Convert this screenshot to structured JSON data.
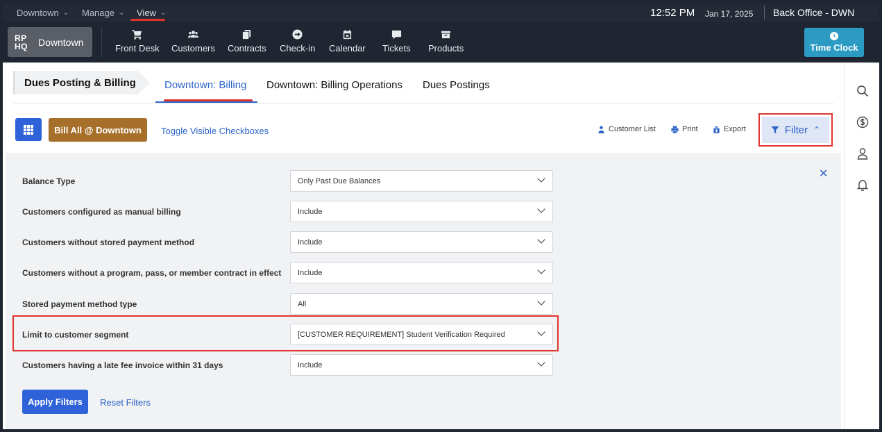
{
  "topbar": {
    "menus": [
      {
        "label": "Downtown"
      },
      {
        "label": "Manage"
      },
      {
        "label": "View"
      }
    ],
    "time": "12:52 PM",
    "date": "Jan 17, 2025",
    "office": "Back Office - DWN"
  },
  "nav": {
    "brand_logo_line1": "RP",
    "brand_logo_line2": "HQ",
    "brand_name": "Downtown",
    "items": [
      {
        "label": "Front Desk",
        "icon": "cart-icon"
      },
      {
        "label": "Customers",
        "icon": "users-icon"
      },
      {
        "label": "Contracts",
        "icon": "contracts-icon"
      },
      {
        "label": "Check-in",
        "icon": "arrow-circle-icon"
      },
      {
        "label": "Calendar",
        "icon": "calendar-icon"
      },
      {
        "label": "Tickets",
        "icon": "chat-icon"
      },
      {
        "label": "Products",
        "icon": "box-icon"
      }
    ],
    "time_clock_label": "Time Clock"
  },
  "breadcrumb": "Dues Posting & Billing",
  "tabs": [
    {
      "label": "Downtown: Billing",
      "active": true
    },
    {
      "label": "Downtown: Billing Operations",
      "active": false
    },
    {
      "label": "Dues Postings",
      "active": false
    }
  ],
  "toolbar": {
    "bill_all_label": "Bill All @ Downtown",
    "toggle_label": "Toggle Visible Checkboxes",
    "customer_list_label": "Customer List",
    "print_label": "Print",
    "export_label": "Export",
    "filter_label": "Filter"
  },
  "filters": [
    {
      "label": "Balance Type",
      "value": "Only Past Due Balances"
    },
    {
      "label": "Customers configured as manual billing",
      "value": "Include"
    },
    {
      "label": "Customers without stored payment method",
      "value": "Include"
    },
    {
      "label": "Customers without a program, pass, or member contract in effect",
      "value": "Include"
    },
    {
      "label": "Stored payment method type",
      "value": "All"
    },
    {
      "label": "Limit to customer segment",
      "value": "[CUSTOMER REQUIREMENT] Student Verification Required"
    },
    {
      "label": "Customers having a late fee invoice within 31 days",
      "value": "Include"
    }
  ],
  "actions": {
    "apply_label": "Apply Filters",
    "reset_label": "Reset Filters"
  },
  "colors": {
    "accent": "#2f62d9",
    "brown_button": "#a6702a",
    "time_clock": "#2b9bc4",
    "highlight": "#e0332f"
  }
}
